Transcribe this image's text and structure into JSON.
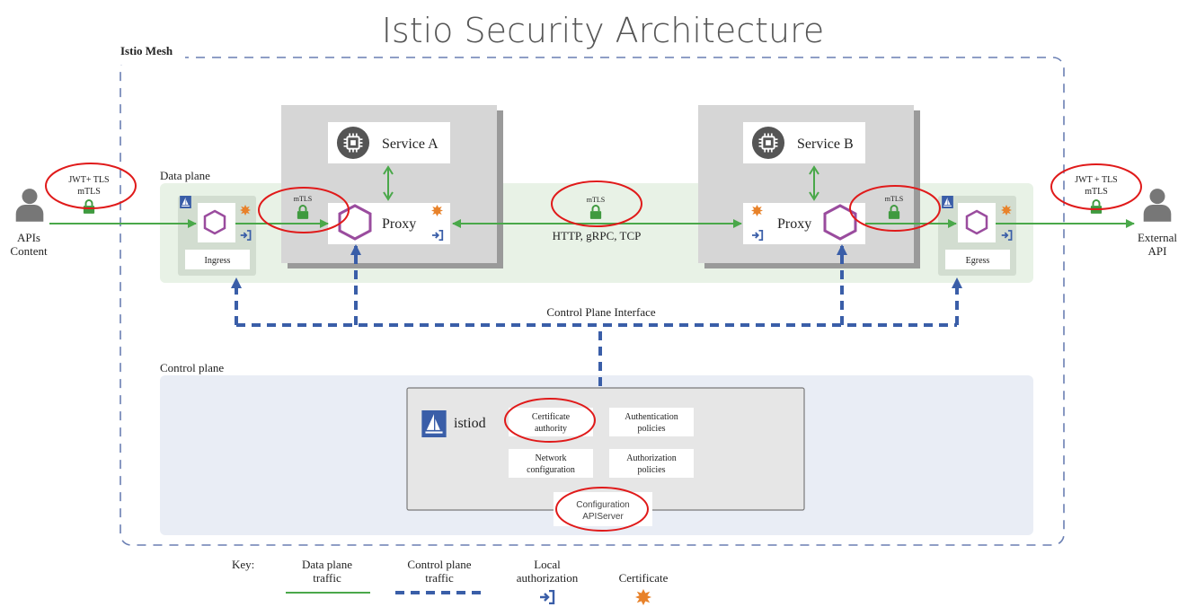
{
  "title": "Istio Security Architecture",
  "mesh_label": "Istio Mesh",
  "data_plane_label": "Data plane",
  "control_plane_label": "Control plane",
  "control_plane_interface_label": "Control Plane Interface",
  "left_actor": {
    "line1": "APIs",
    "line2": "Content",
    "badge_line1": "JWT+ TLS",
    "badge_line2": "mTLS"
  },
  "right_actor": {
    "line1": "External",
    "line2": "API",
    "badge_line1": "JWT + TLS",
    "badge_line2": "mTLS"
  },
  "ingress_label": "Ingress",
  "egress_label": "Egress",
  "service_a": {
    "name": "Service A",
    "proxy": "Proxy",
    "mtls": "mTLS"
  },
  "service_b": {
    "name": "Service B",
    "proxy": "Proxy",
    "mtls": "mTLS"
  },
  "center_link": {
    "mtls": "mTLS",
    "protocols": "HTTP, gRPC, TCP"
  },
  "istiod": {
    "name": "istiod",
    "modules": [
      {
        "line1": "Certificate",
        "line2": "authority"
      },
      {
        "line1": "Authentication",
        "line2": "policies"
      },
      {
        "line1": "Network",
        "line2": "configuration"
      },
      {
        "line1": "Authorization",
        "line2": "policies"
      }
    ],
    "config_line1": "Configuration",
    "config_line2": "APIServer"
  },
  "key": {
    "label": "Key:",
    "data_line1": "Data plane",
    "data_line2": "traffic",
    "control_line1": "Control plane",
    "control_line2": "traffic",
    "local_line1": "Local",
    "local_line2": "authorization",
    "cert": "Certificate"
  },
  "colors": {
    "data_traffic": "#4aa84a",
    "control_traffic": "#3a5ea8",
    "proxy_hex": "#9a4c9e",
    "certificate": "#e8822a",
    "highlight": "#e01a1a",
    "lock": "#3f9a3f"
  }
}
